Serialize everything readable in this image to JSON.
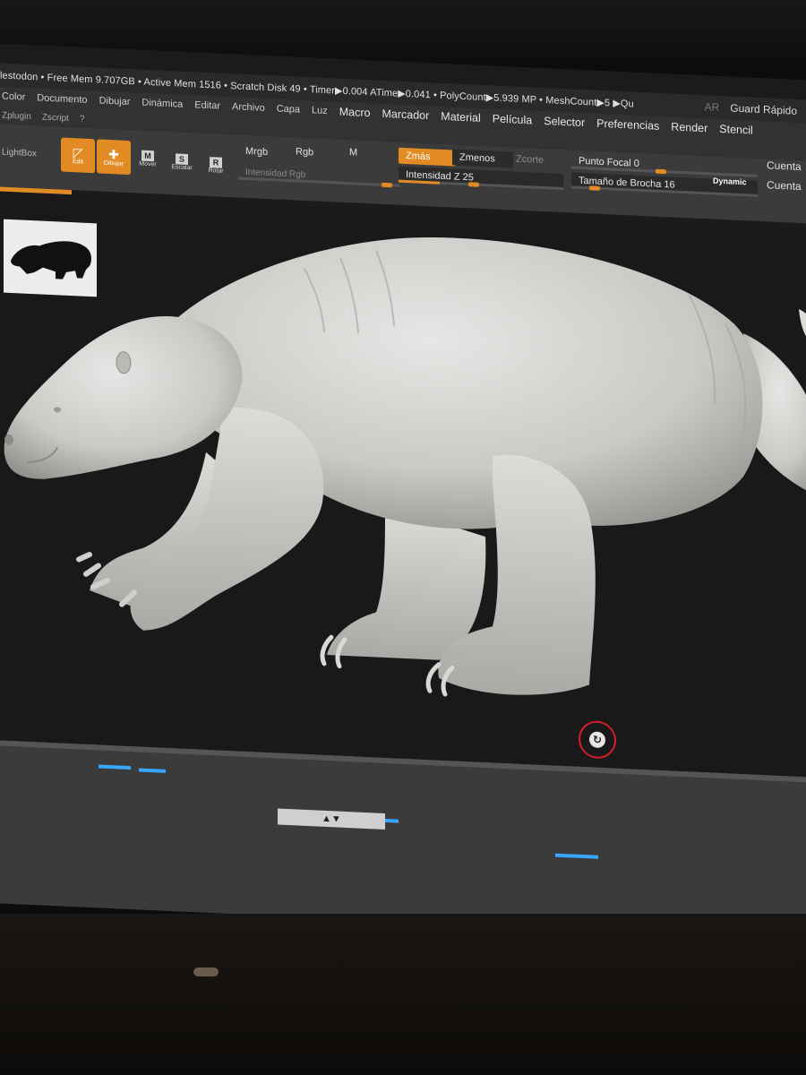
{
  "titlebar": {
    "stats": "lestodon  • Free Mem 9.707GB • Active Mem 1516 • Scratch Disk 49 • Timer▶0.004 ATime▶0.041 • PolyCount▶5.939 MP • MeshCount▶5 ▶Qu",
    "ar": "AR",
    "quick_save": "Guard Rápido"
  },
  "menu": {
    "items": [
      "Color",
      "Documento",
      "Dibujar",
      "Dinámica",
      "Editar",
      "Archivo",
      "Capa",
      "Luz",
      "Macro",
      "Marcador",
      "Material",
      "Película",
      "Selector",
      "Preferencias",
      "Render",
      "Stencil"
    ],
    "row2": [
      "Zplugin",
      "Zscript",
      "?"
    ]
  },
  "toolbar": {
    "lightbox": "LightBox",
    "edit": "Edit",
    "draw": "Dibujar",
    "move": "Mover",
    "scale": "Escalar",
    "rotate": "Rotar",
    "mrgb": "Mrgb",
    "rgb": "Rgb",
    "m": "M",
    "rgb_intensity": "Intensidad Rgb",
    "zadd": "Zmás",
    "zsub": "Zmenos",
    "zcut": "Zcorte",
    "z_intensity": "Intensidad Z 25",
    "z_intensity_value": 25,
    "focal_shift": "Punto Focal 0",
    "focal_shift_value": 0,
    "brush_size": "Tamaño de Brocha 16",
    "brush_size_value": 16,
    "dynamic": "Dynamic",
    "count1": "Cuenta",
    "count2": "Cuenta"
  },
  "colors": {
    "accent": "#e28a24",
    "panel": "#3b3b3b",
    "canvas": "#1a1819",
    "rotate_ring": "#d51e2a",
    "model": "#cfcfcf"
  }
}
